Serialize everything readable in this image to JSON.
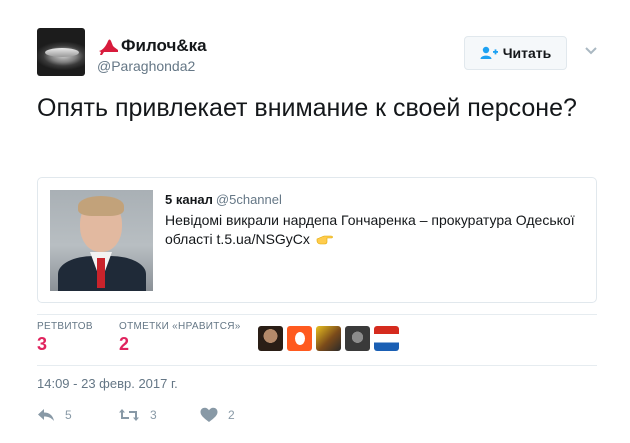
{
  "author": {
    "display_name": "Филоч&ка",
    "handle": "@Paraghonda2",
    "emoji_icon": "high-heel-icon"
  },
  "follow_button": {
    "label": "Читать",
    "icon": "add-user-icon"
  },
  "tweet": {
    "text": "Опять привлекает внимание к своей персоне?"
  },
  "quoted_tweet": {
    "name": "5 канал",
    "handle": "@5channel",
    "text": "Невідомі викрали нардепа Гончаренка – прокуратура Одеської області t.5.ua/NSGyCx",
    "emoji": "pointing-hand-icon"
  },
  "stats": {
    "retweets_label": "РЕТВИТОВ",
    "retweets_count": "3",
    "likes_label": "ОТМЕТКИ «НРАВИТСЯ»",
    "likes_count": "2"
  },
  "timestamp": "14:09 - 23 февр. 2017 г.",
  "actions": {
    "reply_count": "5",
    "retweet_count": "3",
    "like_count": "2"
  },
  "colors": {
    "text": "#14171a",
    "secondary": "#657786",
    "action": "#8899a6",
    "border": "#e1e8ed"
  }
}
